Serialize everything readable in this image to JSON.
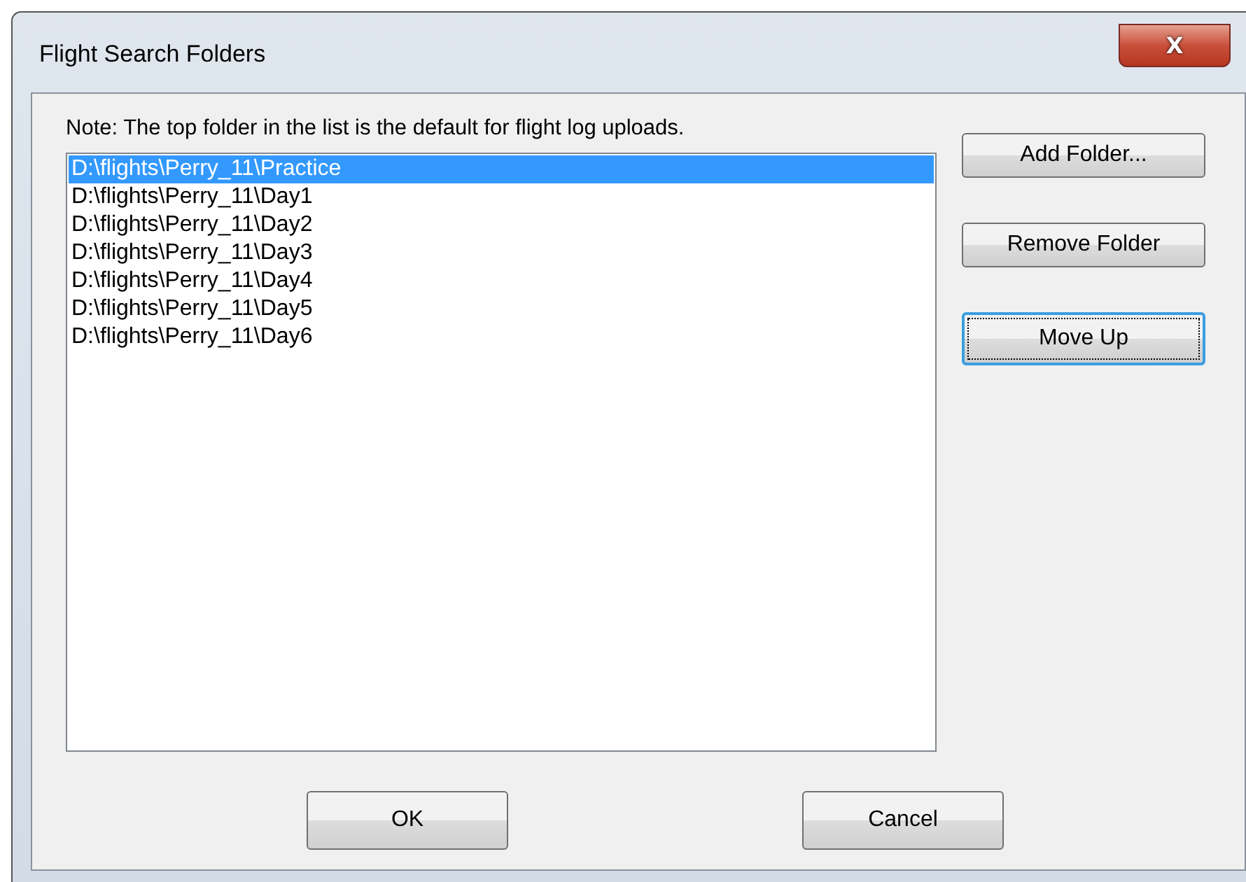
{
  "window": {
    "title": "Flight Search Folders",
    "close": "X"
  },
  "note": "Note: The top folder in the list is the default for flight log uploads.",
  "folders": [
    {
      "path": "D:\\flights\\Perry_11\\Practice",
      "selected": true
    },
    {
      "path": "D:\\flights\\Perry_11\\Day1",
      "selected": false
    },
    {
      "path": "D:\\flights\\Perry_11\\Day2",
      "selected": false
    },
    {
      "path": "D:\\flights\\Perry_11\\Day3",
      "selected": false
    },
    {
      "path": "D:\\flights\\Perry_11\\Day4",
      "selected": false
    },
    {
      "path": "D:\\flights\\Perry_11\\Day5",
      "selected": false
    },
    {
      "path": "D:\\flights\\Perry_11\\Day6",
      "selected": false
    }
  ],
  "side_buttons": [
    {
      "label": "Add Folder...",
      "focused": false
    },
    {
      "label": "Remove Folder",
      "focused": false
    },
    {
      "label": "Move Up",
      "focused": true
    }
  ],
  "buttons": [
    {
      "label": "OK",
      "focused": false
    },
    {
      "label": "Cancel",
      "focused": false
    }
  ]
}
